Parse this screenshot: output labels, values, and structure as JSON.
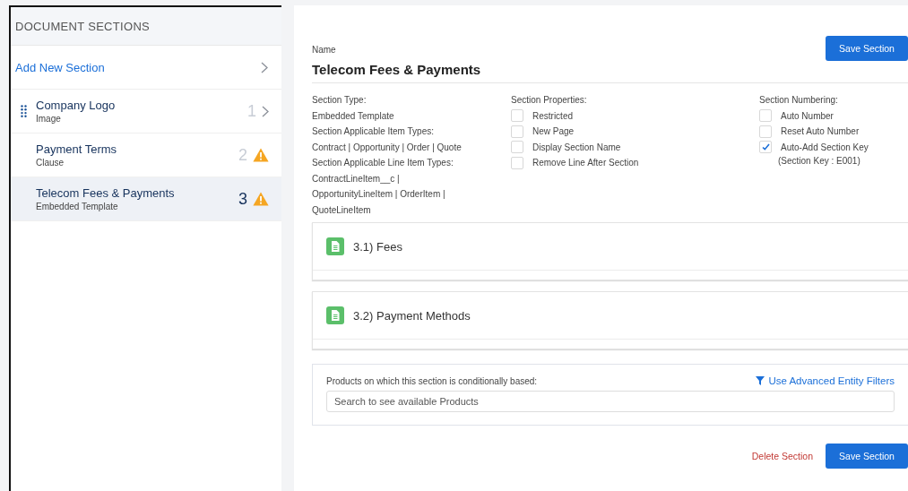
{
  "sidebar": {
    "title": "DOCUMENT SECTIONS",
    "add_link": "Add New Section",
    "items": [
      {
        "title": "Company Logo",
        "subtitle": "Image",
        "number": "1",
        "kind": "chevron",
        "handle": true,
        "selected": false
      },
      {
        "title": "Payment Terms",
        "subtitle": "Clause",
        "number": "2",
        "kind": "warning",
        "handle": false,
        "selected": false
      },
      {
        "title": "Telecom Fees & Payments",
        "subtitle": "Embedded Template",
        "number": "3",
        "kind": "warning",
        "handle": false,
        "selected": true
      }
    ]
  },
  "editor": {
    "name_label": "Name",
    "name_value": "Telecom Fees & Payments",
    "save_button": "Save Section",
    "info": [
      "Section Type:",
      "Embedded Template",
      "Section Applicable Item Types:",
      "Contract | Opportunity | Order | Quote",
      "Section Applicable Line Item Types:",
      "ContractLineItem__c | OpportunityLineItem | OrderItem | QuoteLineItem"
    ],
    "properties": {
      "title": "Section Properties:",
      "options": [
        {
          "label": "Restricted",
          "checked": false
        },
        {
          "label": "New Page",
          "checked": false
        },
        {
          "label": "Display Section Name",
          "checked": false
        },
        {
          "label": "Remove Line After Section",
          "checked": false
        }
      ]
    },
    "numbering": {
      "title": "Section Numbering:",
      "options": [
        {
          "label": "Auto Number",
          "checked": false
        },
        {
          "label": "Reset Auto Number",
          "checked": false
        },
        {
          "label": "Auto-Add Section Key",
          "checked": true
        }
      ],
      "key_note": "(Section Key : E001)"
    },
    "subsections": [
      "3.1) Fees",
      "3.2) Payment Methods"
    ],
    "products": {
      "label": "Products on which this section is conditionally based:",
      "filter_link": "Use Advanced Entity Filters",
      "placeholder": "Search to see available Products"
    },
    "delete_button": "Delete Section",
    "save_button_bottom": "Save Section"
  }
}
